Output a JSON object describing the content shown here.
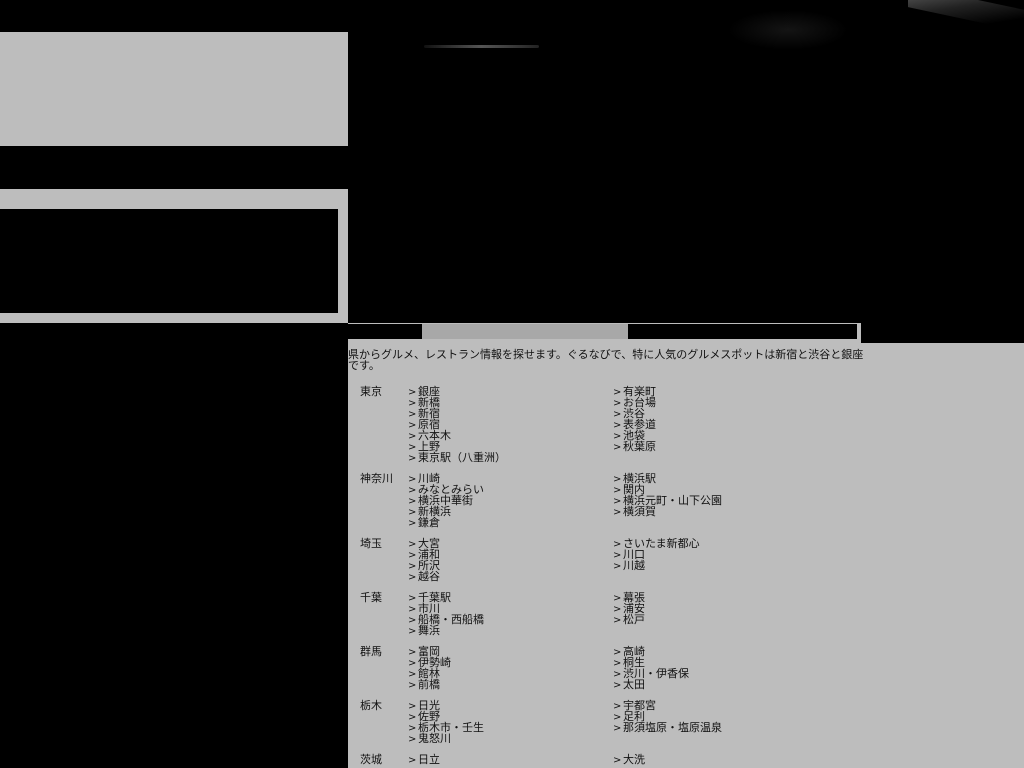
{
  "intro_text": "県からグルメ、レストラン情報を探せます。ぐるなびで、特に人気のグルメスポットは新宿と渋谷と銀座です。",
  "chevron": ">",
  "regions": [
    {
      "name": "東京",
      "col_a": [
        "銀座",
        "新橋",
        "新宿",
        "原宿",
        "六本木",
        "上野",
        "東京駅（八重洲）"
      ],
      "col_b": [
        "有楽町",
        "お台場",
        "渋谷",
        "表参道",
        "池袋",
        "秋葉原"
      ]
    },
    {
      "name": "神奈川",
      "col_a": [
        "川崎",
        "みなとみらい",
        "横浜中華街",
        "新横浜",
        "鎌倉"
      ],
      "col_b": [
        "横浜駅",
        "関内",
        "横浜元町・山下公園",
        "横須賀"
      ]
    },
    {
      "name": "埼玉",
      "col_a": [
        "大宮",
        "浦和",
        "所沢",
        "越谷"
      ],
      "col_b": [
        "さいたま新都心",
        "川口",
        "川越"
      ]
    },
    {
      "name": "千葉",
      "col_a": [
        "千葉駅",
        "市川",
        "船橋・西船橋",
        "舞浜"
      ],
      "col_b": [
        "幕張",
        "浦安",
        "松戸"
      ]
    },
    {
      "name": "群馬",
      "col_a": [
        "富岡",
        "伊勢崎",
        "館林",
        "前橋"
      ],
      "col_b": [
        "高崎",
        "桐生",
        "渋川・伊香保",
        "太田"
      ]
    },
    {
      "name": "栃木",
      "col_a": [
        "日光",
        "佐野",
        "栃木市・壬生",
        "鬼怒川"
      ],
      "col_b": [
        "宇都宮",
        "足利",
        "那須塩原・塩原温泉"
      ]
    },
    {
      "name": "茨城",
      "col_a": [
        "日立"
      ],
      "col_b": [
        "大洗"
      ]
    }
  ]
}
